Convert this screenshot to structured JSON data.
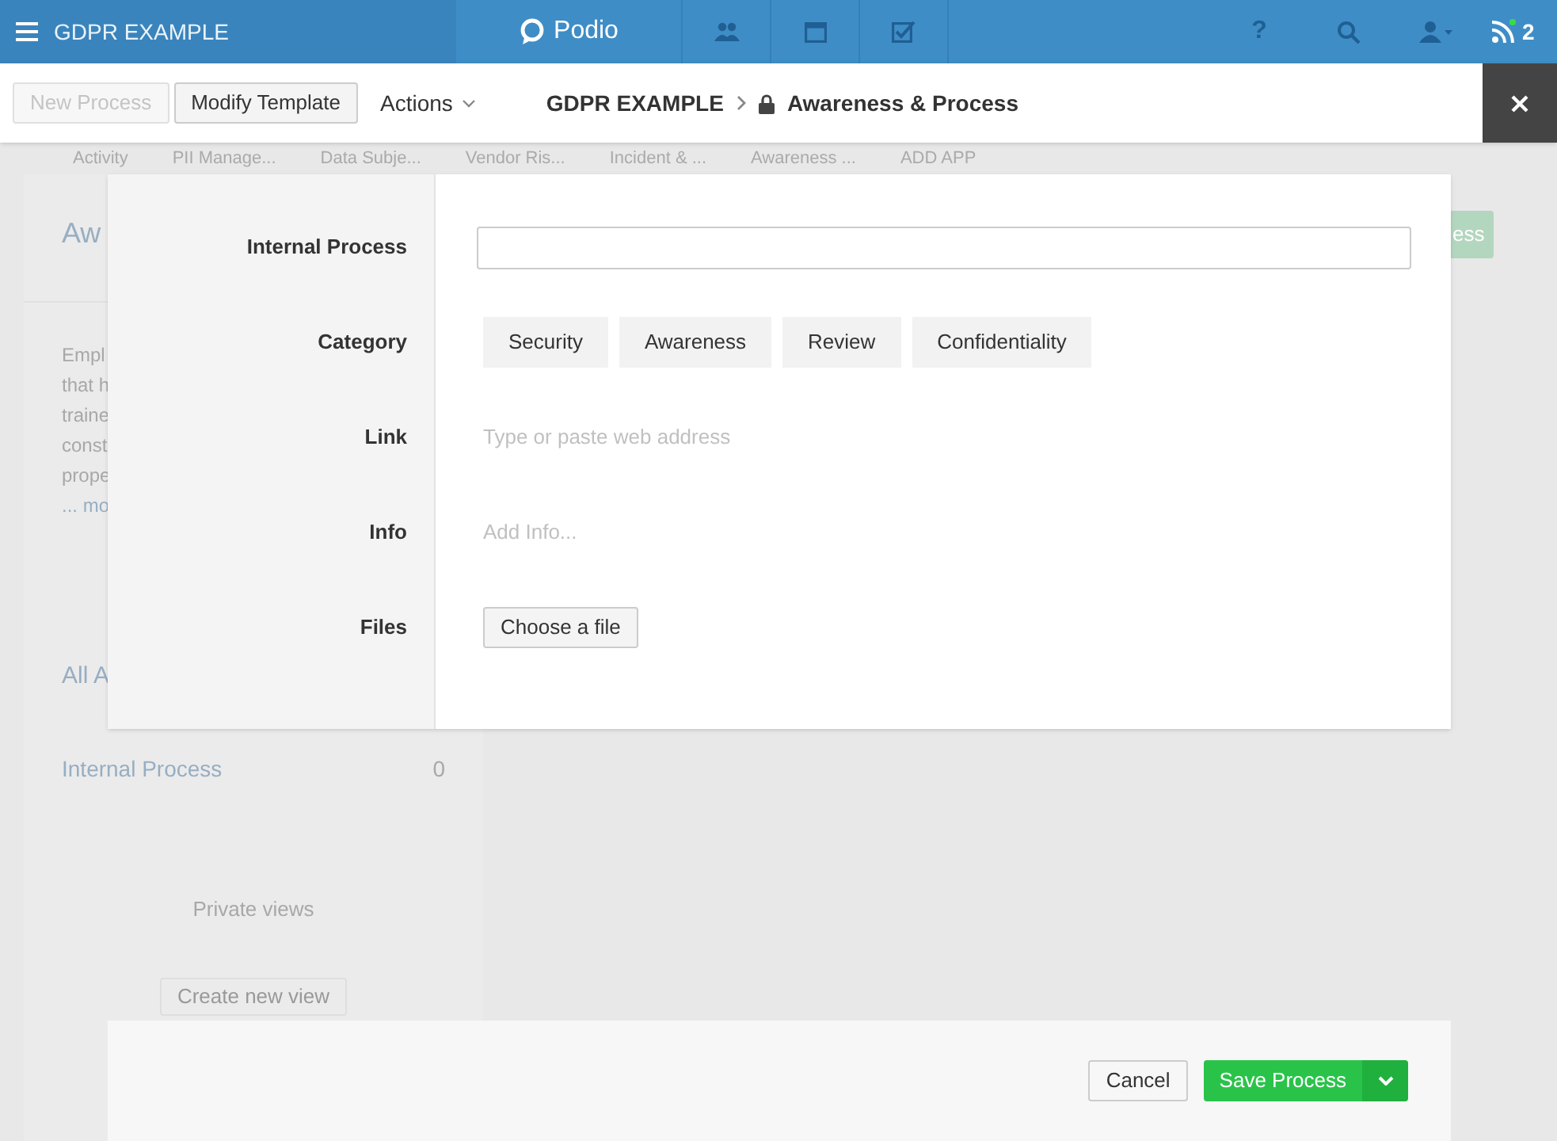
{
  "topbar": {
    "workspace": "GDPR EXAMPLE",
    "brand": "Podio",
    "help": "?",
    "notification_count": "2"
  },
  "toolbar": {
    "buttons": [
      {
        "label": "New Process",
        "disabled": true
      },
      {
        "label": "Modify Template",
        "disabled": false
      }
    ],
    "actions": "Actions",
    "breadcrumb": [
      "GDPR EXAMPLE",
      "Awareness & Process"
    ]
  },
  "background": {
    "app_tabs": [
      "Activity",
      "PII Manage...",
      "Data Subje...",
      "Vendor Ris...",
      "Incident & ...",
      "Awareness ...",
      "ADD APP"
    ],
    "title": "Aw",
    "description": [
      "Empl",
      "that h",
      "traine",
      "const",
      "prope"
    ],
    "more": "... mo",
    "view_heading": "All A",
    "view_row": {
      "name": "Internal Process",
      "count": "0"
    },
    "private_views": "Private views",
    "create_view": "Create new view",
    "side_button": "ess"
  },
  "form": {
    "fields": [
      {
        "label": "Internal Process",
        "kind": "text"
      },
      {
        "label": "Category",
        "kind": "choices",
        "options": [
          {
            "label": "Security",
            "selected": false
          },
          {
            "label": "Awareness",
            "selected": false
          },
          {
            "label": "Review",
            "selected": false
          },
          {
            "label": "Confidentiality",
            "selected": false
          }
        ]
      },
      {
        "label": "Link",
        "kind": "hint",
        "placeholder": "Type or paste web address"
      },
      {
        "label": "Info",
        "kind": "hint",
        "placeholder": "Add Info..."
      },
      {
        "label": "Files",
        "kind": "file",
        "button": "Choose a file"
      }
    ]
  },
  "footer": {
    "cancel": "Cancel",
    "save": "Save Process"
  }
}
